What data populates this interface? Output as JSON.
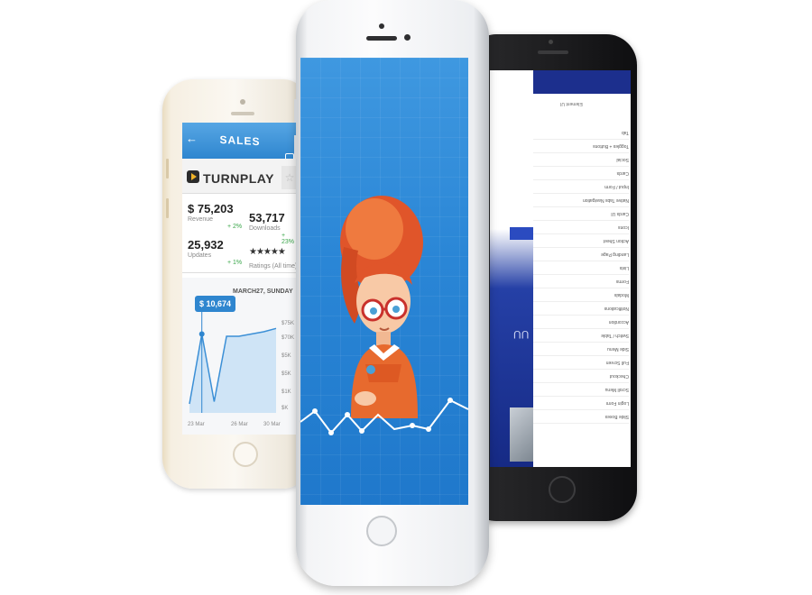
{
  "colors": {
    "sales_header": "#2f86cf",
    "main_screen_blue": "#2a86d6",
    "black_screen_navy": "#1c2f8d",
    "positive_change": "#3aa64a",
    "hair_orange": "#e0552a"
  },
  "gold_phone": {
    "header": {
      "title": "SALES",
      "back_icon": "back-arrow-icon",
      "share_icon": "share-icon"
    },
    "app": {
      "name": "TURNPLAY",
      "favorite_icon": "star-icon"
    },
    "stats": {
      "revenue_value": "$ 75,203",
      "revenue_label": "Revenue",
      "revenue_change": "+ 2%",
      "downloads_value": "53,717",
      "downloads_label": "Downloads",
      "downloads_change": "+ 23%",
      "updates_value": "25,932",
      "updates_label": "Updates",
      "updates_change": "+ 1%",
      "ratings_stars": "★★★★★",
      "ratings_label": "Ratings (All time)"
    },
    "chart": {
      "date_label": "MARCH27, SUNDAY",
      "price_label": "$ 10,674",
      "y_ticks": [
        "$75K",
        "$70K",
        "$5K",
        "$5K",
        "$1K",
        "$K"
      ],
      "x_ticks": [
        "23 Mar",
        "26 Mar",
        "30 Mar"
      ]
    }
  },
  "black_phone": {
    "menu_header": "Element UI",
    "menu_items": [
      "Tab",
      "Toggles + Buttons",
      "Social",
      "Cards",
      "Input / Form",
      "Native Tabs Navigation",
      "Cards UI",
      "Icons",
      "Action Sheet",
      "Landing Page",
      "Lists",
      "Forms",
      "Modals",
      "Notifications",
      "Accordion",
      "Switch / Table",
      "Side Menu",
      "Full Screen",
      "Checkout",
      "Scroll Menu",
      "Login Form",
      "Slide Boxes"
    ],
    "partial_heading": "UU"
  },
  "chart_data": {
    "type": "line",
    "title": "",
    "xlabel": "",
    "ylabel": "",
    "x": [
      "23 Mar",
      "24 Mar",
      "25 Mar",
      "26 Mar",
      "27 Mar",
      "28 Mar",
      "29 Mar",
      "30 Mar"
    ],
    "series": [
      {
        "values": [
          8,
          70,
          10,
          68,
          68,
          70,
          72,
          75
        ]
      }
    ],
    "ylim": [
      0,
      80
    ],
    "grid": false,
    "highlight": {
      "x": "24 Mar",
      "value": 10674
    }
  }
}
